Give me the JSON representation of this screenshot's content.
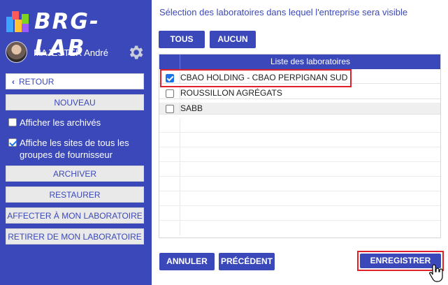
{
  "app": {
    "logo_text": "BRG-LAB"
  },
  "user": {
    "name": "MAJESTER André"
  },
  "sidebar": {
    "back_label": "RETOUR",
    "new_label": "NOUVEAU",
    "show_archived_label": "Afficher les archivés",
    "show_archived_checked": false,
    "show_all_sites_label_line1": "Affiche les sites de tous les",
    "show_all_sites_label_line2": "groupes de fournisseur",
    "show_all_sites_checked": true,
    "archive_label": "ARCHIVER",
    "restore_label": "RESTAURER",
    "assign_label": "AFFECTER À MON LABORATOIRE",
    "remove_label": "RETIRER DE MON LABORATOIRE"
  },
  "main": {
    "title": "Sélection des laboratoires dans lequel l'entreprise sera visible",
    "all_label": "TOUS",
    "none_label": "AUCUN",
    "table": {
      "header": "Liste des laboratoires",
      "rows": [
        {
          "name": "CBAO HOLDING - CBAO PERPIGNAN SUD",
          "checked": true
        },
        {
          "name": "ROUSSILLON AGRÉGATS",
          "checked": false
        },
        {
          "name": "SABB",
          "checked": false
        }
      ]
    },
    "cancel_label": "ANNULER",
    "previous_label": "PRÉCÉDENT",
    "save_label": "ENREGISTRER"
  },
  "colors": {
    "primary": "#3b48b9",
    "highlight": "#e0202a",
    "button_light": "#e9e9e9"
  }
}
